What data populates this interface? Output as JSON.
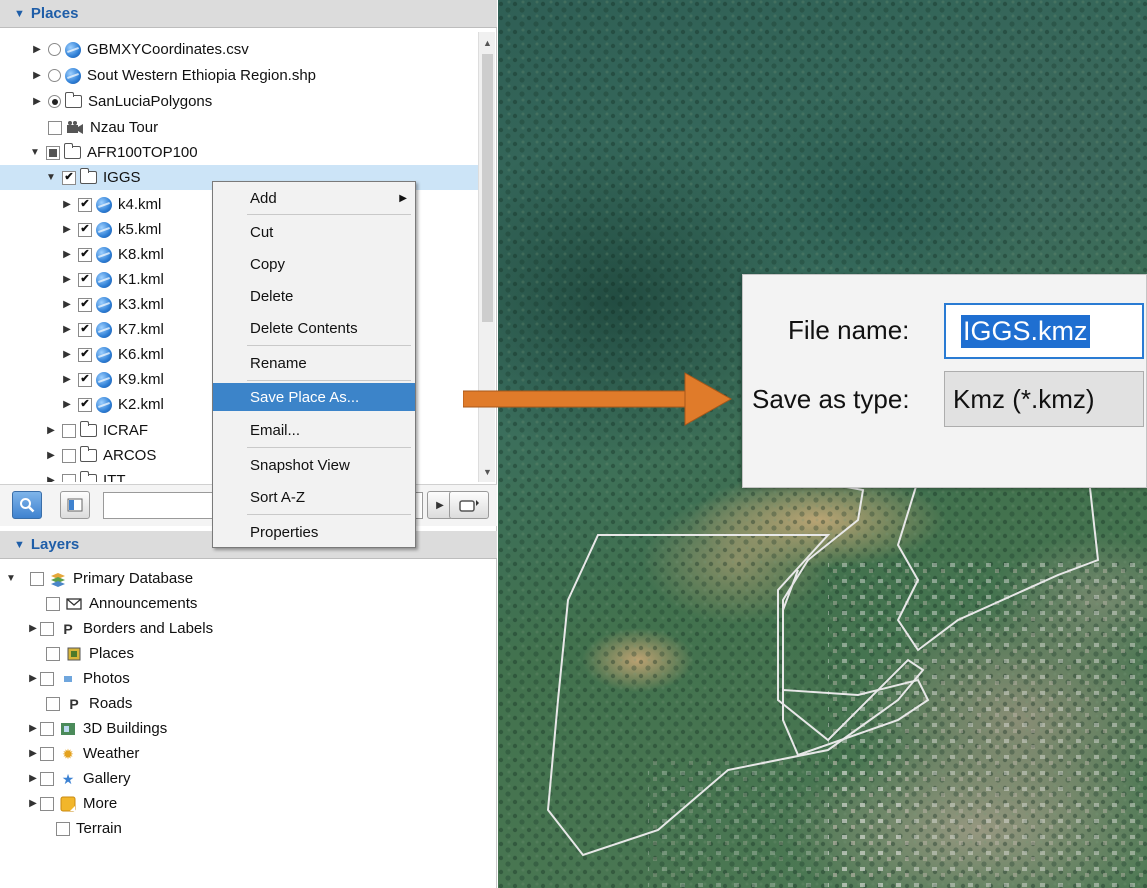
{
  "places": {
    "header": "Places",
    "items": [
      {
        "label": "GBMXYCoordinates.csv"
      },
      {
        "label": "Sout Western Ethiopia Region.shp"
      },
      {
        "label": "SanLuciaPolygons"
      },
      {
        "label": "Nzau Tour"
      },
      {
        "label": "AFR100TOP100"
      },
      {
        "label": "IGGS"
      },
      {
        "label": "k4.kml"
      },
      {
        "label": "k5.kml"
      },
      {
        "label": "K8.kml"
      },
      {
        "label": "K1.kml"
      },
      {
        "label": "K3.kml"
      },
      {
        "label": "K7.kml"
      },
      {
        "label": "K6.kml"
      },
      {
        "label": "K9.kml"
      },
      {
        "label": "K2.kml"
      },
      {
        "label": "ICRAF"
      },
      {
        "label": "ARCOS"
      },
      {
        "label": "ITT"
      }
    ]
  },
  "layers": {
    "header": "Layers",
    "items": [
      {
        "label": "Primary Database"
      },
      {
        "label": "Announcements"
      },
      {
        "label": "Borders and Labels"
      },
      {
        "label": "Places"
      },
      {
        "label": "Photos"
      },
      {
        "label": "Roads"
      },
      {
        "label": "3D Buildings"
      },
      {
        "label": "Weather"
      },
      {
        "label": "Gallery"
      },
      {
        "label": "More"
      },
      {
        "label": "Terrain"
      }
    ]
  },
  "context_menu": {
    "items": [
      {
        "label": "Add"
      },
      {
        "label": "Cut"
      },
      {
        "label": "Copy"
      },
      {
        "label": "Delete"
      },
      {
        "label": "Delete Contents"
      },
      {
        "label": "Rename"
      },
      {
        "label": "Save Place As..."
      },
      {
        "label": "Email..."
      },
      {
        "label": "Snapshot View"
      },
      {
        "label": "Sort A-Z"
      },
      {
        "label": "Properties"
      }
    ]
  },
  "save_dialog": {
    "file_name_label": "File name:",
    "file_name_value": "IGGS.kmz",
    "save_type_label": "Save as type:",
    "save_type_value": "Kmz (*.kmz)"
  },
  "colors": {
    "accent": "#1f5ea8",
    "selection": "#cce4f7",
    "menu_highlight": "#3c84c9",
    "arrow": "#e07b2a"
  }
}
